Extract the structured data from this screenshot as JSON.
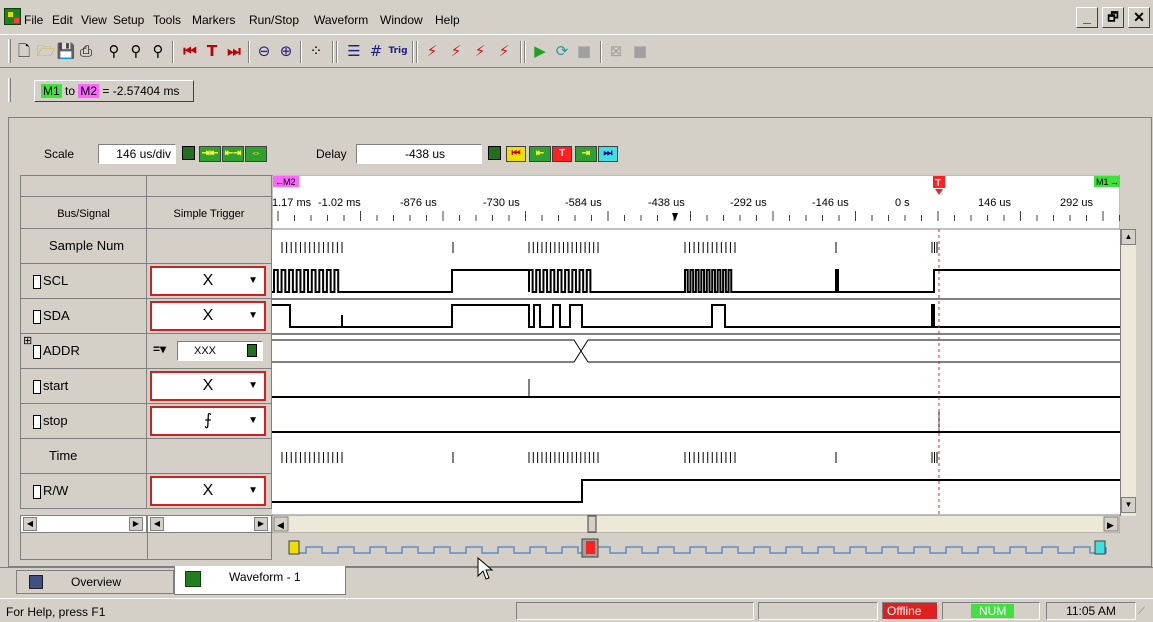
{
  "menu": [
    "File",
    "Edit",
    "View",
    "Setup",
    "Tools",
    "Markers",
    "Run/Stop",
    "Waveform",
    "Window",
    "Help"
  ],
  "window_buttons": [
    "_",
    "🗗",
    "✕"
  ],
  "marker": {
    "m1": "M1",
    "to": "to",
    "m2": "M2",
    "value": "= -2.57404 ms"
  },
  "scale": {
    "label": "Scale",
    "value": "146 us/div",
    "delay_label": "Delay",
    "delay_value": "-438 us"
  },
  "headers": {
    "bus_signal": "Bus/Signal",
    "simple_trigger": "Simple Trigger"
  },
  "signals": [
    {
      "name": "Sample Num",
      "icon": false,
      "trigger": ""
    },
    {
      "name": "SCL",
      "icon": true,
      "trigger": "X"
    },
    {
      "name": "SDA",
      "icon": true,
      "trigger": "X"
    },
    {
      "name": "ADDR",
      "icon": true,
      "trigger": "= XXX"
    },
    {
      "name": "start",
      "icon": true,
      "trigger": "X"
    },
    {
      "name": "stop",
      "icon": true,
      "trigger": "edge-falling"
    },
    {
      "name": "Time",
      "icon": false,
      "trigger": ""
    },
    {
      "name": "R/W",
      "icon": true,
      "trigger": "X"
    }
  ],
  "trigger_addr_value": "XXX",
  "ruler": {
    "m2_label": "M2",
    "m1_label": "M1",
    "trigger_label": "T",
    "ticks": [
      "1.17 ms",
      "-1.02 ms",
      "-876 us",
      "-730 us",
      "-584 us",
      "-438 us",
      "-292 us",
      "-146 us",
      "0 s",
      "146 us",
      "292 us"
    ]
  },
  "tabs": [
    {
      "label": "Overview"
    },
    {
      "label": "Waveform - 1"
    }
  ],
  "status": {
    "help": "For Help, press F1",
    "offline": "Offline",
    "num": "NUM",
    "time": "11:05 AM"
  }
}
